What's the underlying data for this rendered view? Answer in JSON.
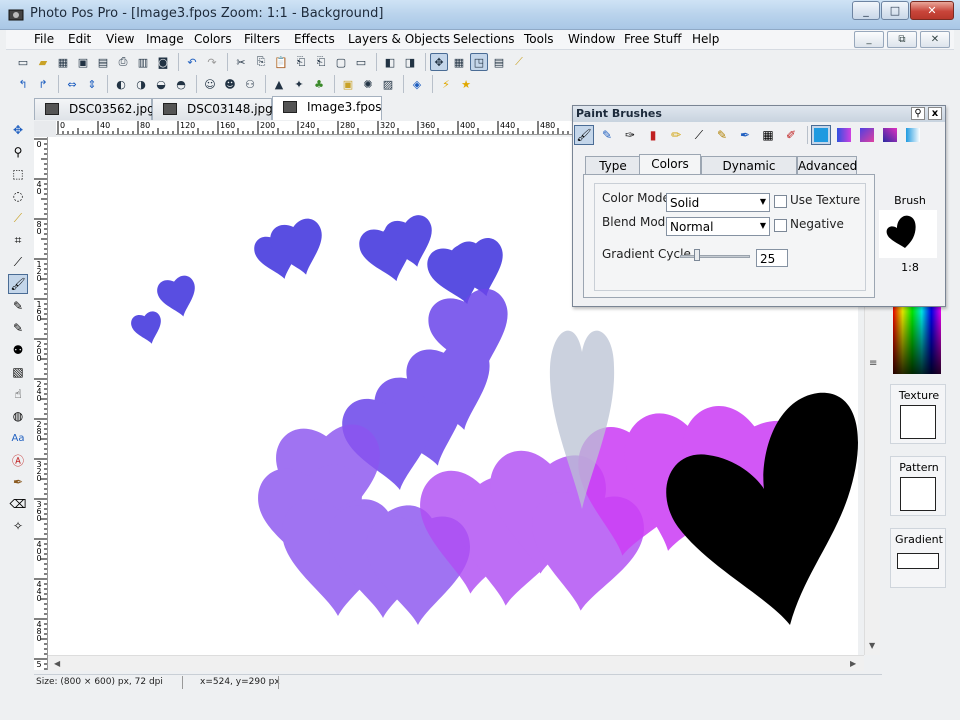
{
  "window": {
    "title": "Photo Pos Pro - [Image3.fpos  Zoom: 1:1 - Background]",
    "buttons": [
      "_",
      "□",
      "✕"
    ]
  },
  "menu": [
    "File",
    "Edit",
    "View",
    "Image",
    "Colors",
    "Filters",
    "Effects",
    "Layers & Objects",
    "Selections",
    "Tools",
    "Window",
    "Free Stuff",
    "Help"
  ],
  "mdi_buttons": [
    "_",
    "⧉",
    "✕"
  ],
  "tabs": [
    {
      "label": "DSC03562.jpg"
    },
    {
      "label": "DSC03148.jpg"
    },
    {
      "label": "Image3.fpos"
    }
  ],
  "rulers": {
    "h_labels": [
      "0",
      "40",
      "80",
      "120",
      "160",
      "200",
      "240",
      "280",
      "320",
      "360",
      "400",
      "440",
      "480"
    ],
    "v_labels": [
      "0",
      "4 0",
      "8 0",
      "1 2 0",
      "1 6 0",
      "2 0 0",
      "2 4 0",
      "2 8 0",
      "3 2 0",
      "3 6 0",
      "4 0 0",
      "4 4 0",
      "4 8 0",
      "5"
    ]
  },
  "paint_brushes": {
    "title": "Paint Brushes",
    "pin": "⚲",
    "close": "x",
    "tabs": [
      "Type",
      "Colors",
      "Dynamic Changes",
      "Advanced"
    ],
    "color_mode_label": "Color Mode",
    "color_mode_value": "Solid",
    "blend_mode_label": "Blend Mode",
    "blend_mode_value": "Normal",
    "use_texture_label": "Use Texture",
    "negative_label": "Negative",
    "gradient_cycle_label": "Gradient Cycle",
    "gradient_cycle_value": "25",
    "brush_label": "Brush",
    "brush_size": "1:8"
  },
  "side_panels": {
    "texture": "Texture",
    "pattern": "Pattern",
    "gradient": "Gradient"
  },
  "status": {
    "size": "Size: (800 × 600) px, 72 dpi",
    "coords": "x=524, y=290 px"
  },
  "colors": {
    "accent_purple": "#5a3be0",
    "magenta": "#c944f5",
    "black": "#000000"
  }
}
